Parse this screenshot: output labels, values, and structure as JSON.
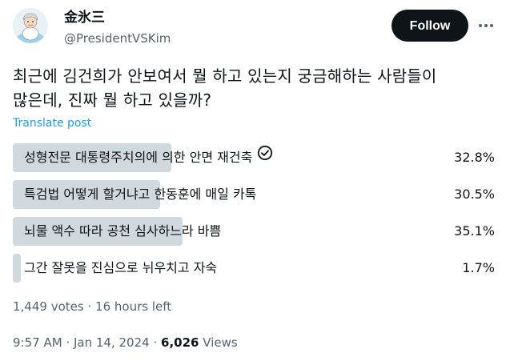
{
  "author": {
    "display_name": "金氷三",
    "handle": "@PresidentVSKim"
  },
  "actions": {
    "follow_label": "Follow",
    "more_icon": "more-horizontal-icon"
  },
  "post": {
    "text_line1": "최근에 김건희가 안보여서 뭘 하고 있는지 궁금해하는 사람들이",
    "text_line2": "많은데, 진짜 뭘 하고 있을까?",
    "translate_label": "Translate post"
  },
  "poll": {
    "bar_color": "#cfd9de",
    "options": [
      {
        "label": "성형전문 대통령주치의에 의한 안면 재건축",
        "percent_label": "32.8%",
        "percent": 32.8,
        "winner": true
      },
      {
        "label": "특검법 어떻게 할거냐고 한동훈에 매일 카톡",
        "percent_label": "30.5%",
        "percent": 30.5,
        "winner": false
      },
      {
        "label": "뇌물 액수 따라 공천 심사하느라 바쁨",
        "percent_label": "35.1%",
        "percent": 35.1,
        "winner": false
      },
      {
        "label": "그간 잘못을 진심으로 뉘우치고 자숙",
        "percent_label": "1.7%",
        "percent": 1.7,
        "winner": false
      }
    ],
    "votes": "1,449 votes",
    "separator": "·",
    "time_left": "16 hours left"
  },
  "meta": {
    "time": "9:57 AM",
    "separator": "·",
    "date": "Jan 14, 2024",
    "views_count": "6,026",
    "views_label": "Views"
  }
}
